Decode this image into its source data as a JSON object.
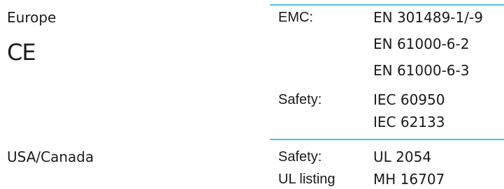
{
  "regions": {
    "europe": {
      "name": "Europe",
      "mark": "CE",
      "rows": [
        {
          "label": "EMC:",
          "values": [
            "EN 301489-1/-9",
            "EN 61000-6-2",
            "EN 61000-6-3"
          ]
        },
        {
          "label": "Safety:",
          "values": [
            "IEC 60950",
            "IEC 62133"
          ]
        }
      ]
    },
    "usa_canada": {
      "name": "USA/Canada",
      "rows": [
        {
          "label": "Safety:",
          "values": [
            "UL 2054"
          ]
        },
        {
          "label": "UL listing",
          "values": [
            "MH 16707"
          ]
        }
      ]
    }
  },
  "colors": {
    "rule": "#4cc0f0",
    "text": "#1a1a1a"
  }
}
